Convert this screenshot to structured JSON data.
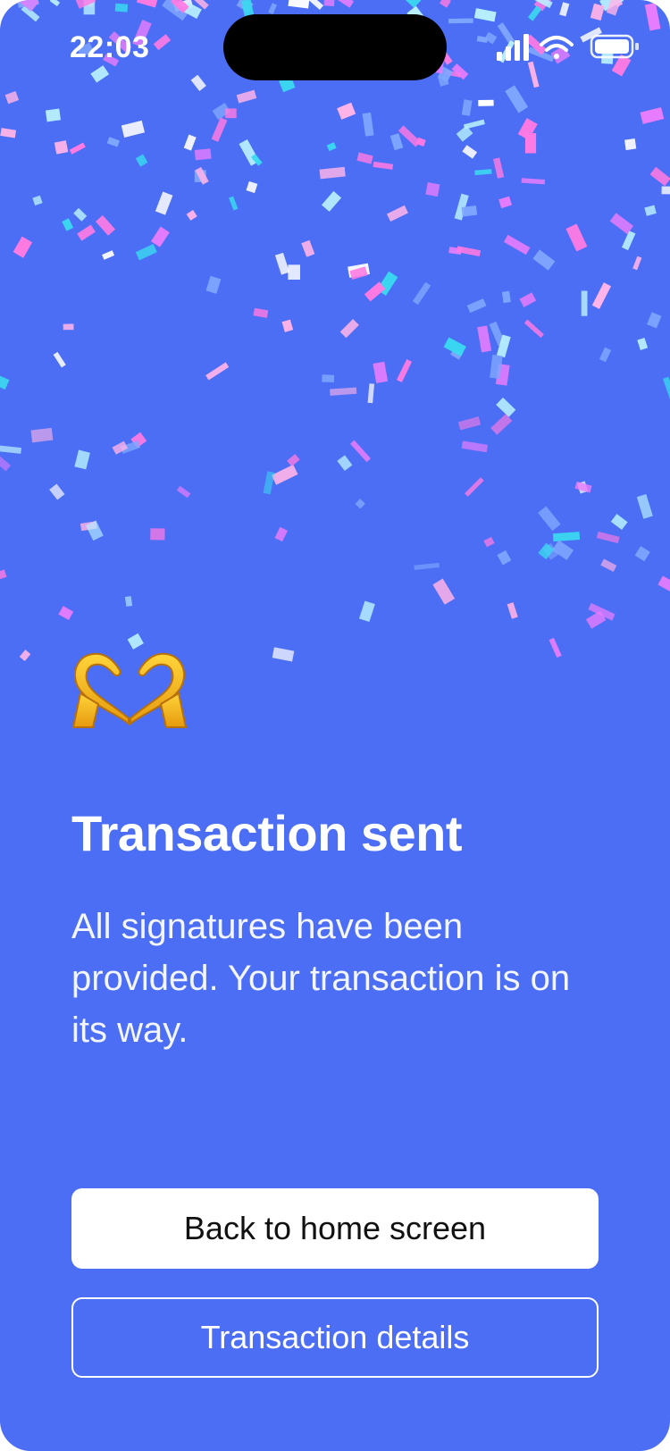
{
  "status_bar": {
    "time": "22:03",
    "icons": [
      "cellular-signal-icon",
      "wifi-icon",
      "battery-icon"
    ]
  },
  "hero": {
    "icon": "heart-hands-emoji",
    "title": "Transaction sent",
    "message": "All signatures have been provided. Your transaction is on its way."
  },
  "actions": {
    "primary_label": "Back to home screen",
    "secondary_label": "Transaction details"
  },
  "colors": {
    "background": "#4b6ef5",
    "confetti": [
      "#ff7ae3",
      "#e97cff",
      "#ffffff",
      "#3ad9f0",
      "#b8f0ff",
      "#ffb3e8",
      "#7fa6ff"
    ]
  }
}
